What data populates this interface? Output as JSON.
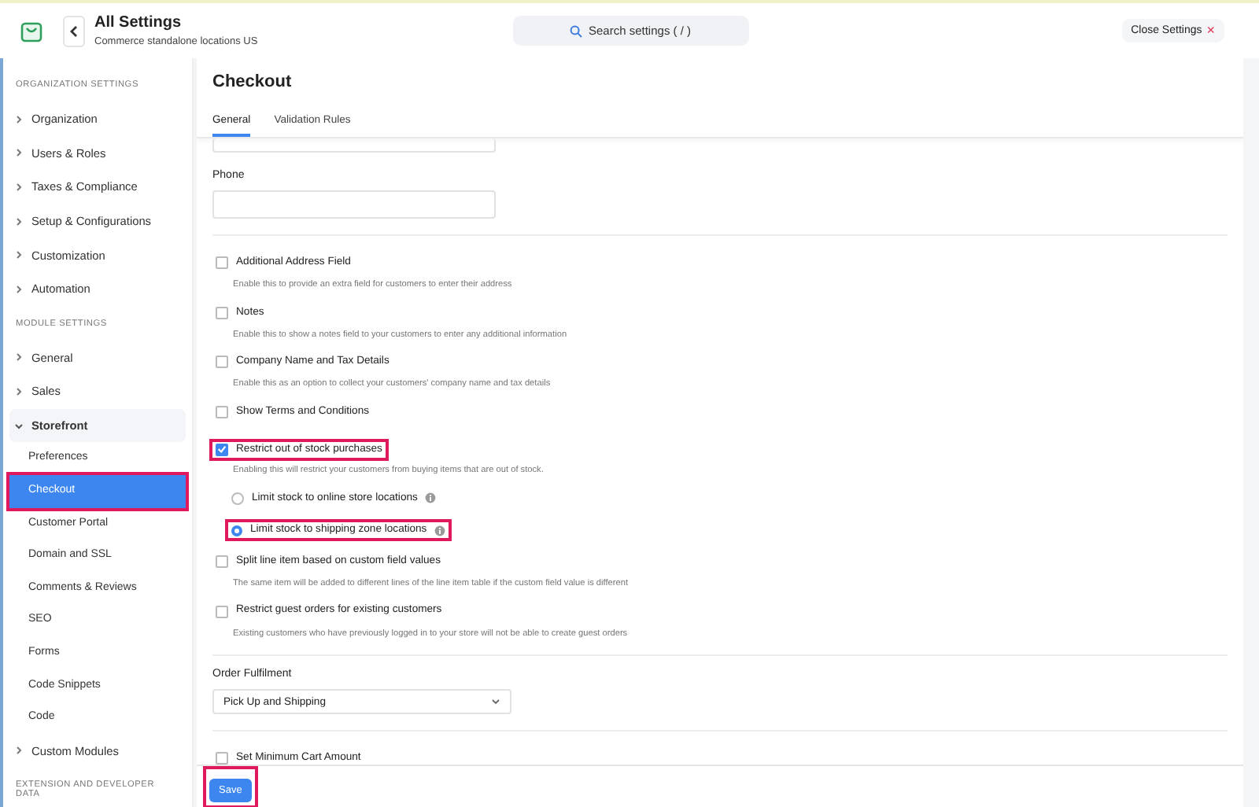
{
  "header": {
    "title": "All Settings",
    "subtitle": "Commerce standalone locations US",
    "search_placeholder": "Search settings ( / )",
    "close_label": "Close Settings",
    "close_glyph": "×"
  },
  "sidebar": {
    "sections": [
      {
        "heading": "ORGANIZATION SETTINGS",
        "items": [
          {
            "label": "Organization",
            "expanded": false
          },
          {
            "label": "Users & Roles",
            "expanded": false
          },
          {
            "label": "Taxes & Compliance",
            "expanded": false
          },
          {
            "label": "Setup & Configurations",
            "expanded": false
          },
          {
            "label": "Customization",
            "expanded": false
          },
          {
            "label": "Automation",
            "expanded": false
          }
        ]
      },
      {
        "heading": "MODULE SETTINGS",
        "items": [
          {
            "label": "General",
            "expanded": false
          },
          {
            "label": "Sales",
            "expanded": false
          },
          {
            "label": "Storefront",
            "expanded": true,
            "children": [
              {
                "label": "Preferences",
                "selected": false,
                "highlighted": false
              },
              {
                "label": "Checkout",
                "selected": true,
                "highlighted": true
              },
              {
                "label": "Customer Portal",
                "selected": false,
                "highlighted": false
              },
              {
                "label": "Domain and SSL",
                "selected": false,
                "highlighted": false
              },
              {
                "label": "Comments & Reviews",
                "selected": false,
                "highlighted": false
              },
              {
                "label": "SEO",
                "selected": false,
                "highlighted": false
              },
              {
                "label": "Forms",
                "selected": false,
                "highlighted": false
              },
              {
                "label": "Code Snippets",
                "selected": false,
                "highlighted": false
              },
              {
                "label": "Code",
                "selected": false,
                "highlighted": false
              }
            ]
          },
          {
            "label": "Custom Modules",
            "expanded": false
          }
        ]
      },
      {
        "heading": "EXTENSION AND DEVELOPER DATA"
      }
    ]
  },
  "main": {
    "title": "Checkout",
    "tabs": [
      {
        "label": "General",
        "selected": true
      },
      {
        "label": "Validation Rules",
        "selected": false
      }
    ],
    "fields": [
      {
        "label": "Phone"
      }
    ],
    "options": [
      {
        "kind": "checkbox",
        "label": "Additional Address Field",
        "description": "Enable this to provide an extra field for customers to enter their address",
        "checked": false,
        "highlighted": false
      },
      {
        "kind": "checkbox",
        "label": "Notes",
        "description": "Enable this to show a notes field to your customers to enter any additional information",
        "checked": false,
        "highlighted": false
      },
      {
        "kind": "checkbox",
        "label": "Company Name and Tax Details",
        "description": "Enable this as an option to collect your customers' company name and tax details",
        "checked": false,
        "highlighted": false
      },
      {
        "kind": "checkbox",
        "label": "Show Terms and Conditions",
        "checked": false,
        "highlighted": false
      },
      {
        "kind": "checkbox",
        "label": "Restrict out of stock purchases",
        "description": "Enabling this will restrict your customers from buying items that are out of stock.",
        "checked": true,
        "highlighted": true,
        "children": [
          {
            "kind": "radio",
            "label": "Limit stock to online store locations",
            "selected": false,
            "highlighted": false
          },
          {
            "kind": "radio",
            "label": "Limit stock to shipping zone locations",
            "selected": true,
            "highlighted": true
          }
        ]
      },
      {
        "kind": "checkbox",
        "label": "Split line item based on custom field values",
        "description": "The same item will be added to different lines of the line item table if the custom field value is different",
        "checked": false,
        "highlighted": false
      },
      {
        "kind": "checkbox",
        "label": "Restrict guest orders for existing customers",
        "description": "Existing customers who have previously logged in to your store will not be able to create guest orders",
        "checked": false,
        "highlighted": false
      }
    ],
    "fulfilment": {
      "label": "Order Fulfilment",
      "value": "Pick Up and Shipping"
    },
    "min_cart": {
      "label": "Set Minimum Cart Amount",
      "checked": false
    },
    "save": {
      "label": "Save",
      "highlighted": true
    }
  }
}
